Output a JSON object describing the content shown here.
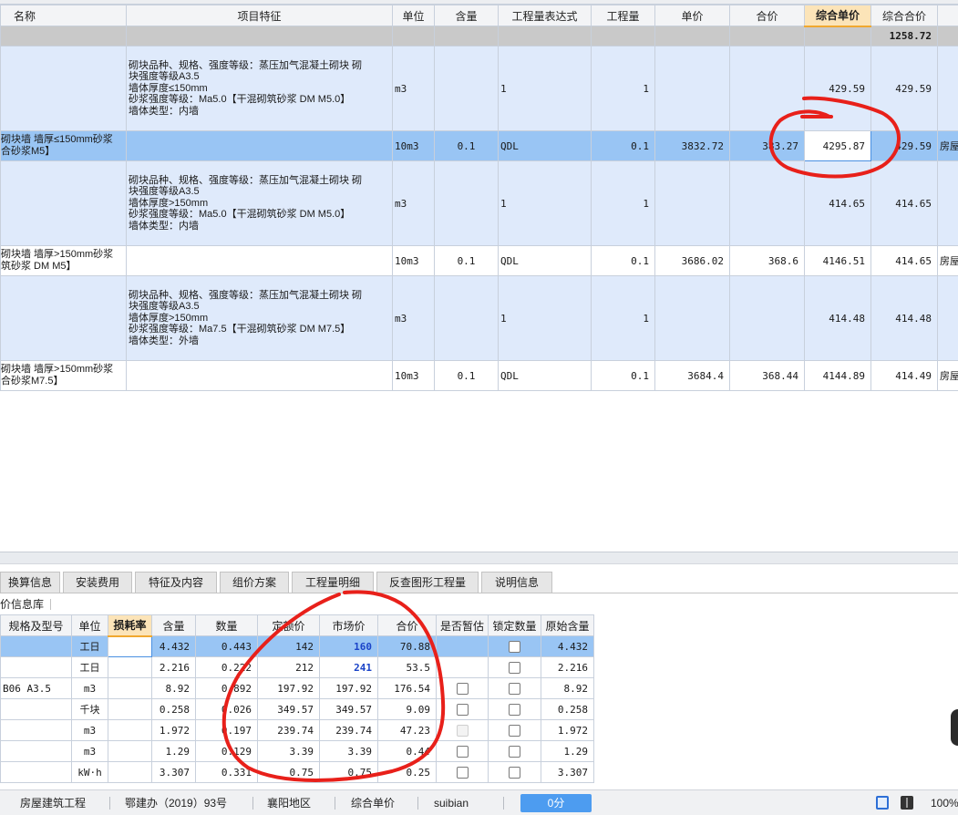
{
  "top_headers": [
    "名称",
    "项目特征",
    "单位",
    "含量",
    "工程量表达式",
    "工程量",
    "单价",
    "合价",
    "综合单价",
    "综合合价",
    ""
  ],
  "summary_total": "1258.72",
  "rows": [
    {
      "kind": "desc",
      "name": "",
      "feature": [
        "砌块品种、规格、强度等级：蒸压加气混凝土砌块 砌",
        "块强度等级A3.5",
        "墙体厚度≤150mm",
        "砂浆强度等级：Ma5.0【干混砌筑砂浆 DM M5.0】",
        "墙体类型：内墙"
      ],
      "unit": "m3",
      "content": "",
      "expr": "1",
      "qty": "1",
      "price": "",
      "total": "",
      "comp_price": "429.59",
      "comp_total": "429.59",
      "extra": ""
    },
    {
      "kind": "sel",
      "name": [
        "砌块墙 墙厚≤150mm砂浆",
        "合砂浆M5】"
      ],
      "feature": [],
      "unit": "10m3",
      "content": "0.1",
      "expr": "QDL",
      "qty": "0.1",
      "price": "3832.72",
      "total": "383.27",
      "comp_price": "4295.87",
      "comp_total": "429.59",
      "extra": "房屋"
    },
    {
      "kind": "desc",
      "name": "",
      "feature": [
        "砌块品种、规格、强度等级：蒸压加气混凝土砌块 砌",
        "块强度等级A3.5",
        "墙体厚度>150mm",
        "砂浆强度等级：Ma5.0【干混砌筑砂浆 DM M5.0】",
        "墙体类型：内墙"
      ],
      "unit": "m3",
      "content": "",
      "expr": "1",
      "qty": "1",
      "price": "",
      "total": "",
      "comp_price": "414.65",
      "comp_total": "414.65",
      "extra": ""
    },
    {
      "kind": "sub",
      "name": [
        "砌块墙 墙厚>150mm砂浆",
        "筑砂浆 DM M5】"
      ],
      "feature": [],
      "unit": "10m3",
      "content": "0.1",
      "expr": "QDL",
      "qty": "0.1",
      "price": "3686.02",
      "total": "368.6",
      "comp_price": "4146.51",
      "comp_total": "414.65",
      "extra": "房屋"
    },
    {
      "kind": "desc",
      "name": "",
      "feature": [
        "砌块品种、规格、强度等级：蒸压加气混凝土砌块 砌",
        "块强度等级A3.5",
        "墙体厚度>150mm",
        "砂浆强度等级：Ma7.5【干混砌筑砂浆 DM M7.5】",
        "墙体类型：外墙"
      ],
      "unit": "m3",
      "content": "",
      "expr": "1",
      "qty": "1",
      "price": "",
      "total": "",
      "comp_price": "414.48",
      "comp_total": "414.48",
      "extra": ""
    },
    {
      "kind": "sub",
      "name": [
        "砌块墙 墙厚>150mm砂浆",
        "合砂浆M7.5】"
      ],
      "feature": [],
      "unit": "10m3",
      "content": "0.1",
      "expr": "QDL",
      "qty": "0.1",
      "price": "3684.4",
      "total": "368.44",
      "comp_price": "4144.89",
      "comp_total": "414.49",
      "extra": "房屋"
    }
  ],
  "tabs": [
    "换算信息",
    "安装费用",
    "特征及内容",
    "组价方案",
    "工程量明细",
    "反查图形工程量",
    "说明信息"
  ],
  "lib_label": "价信息库",
  "bottom_headers": [
    "规格及型号",
    "单位",
    "损耗率",
    "含量",
    "数量",
    "定额价",
    "市场价",
    "合价",
    "是否暂估",
    "锁定数量",
    "原始含量"
  ],
  "bottom_rows": [
    {
      "spec": "",
      "unit": "工日",
      "loss": "",
      "content": "4.432",
      "qty": "0.443",
      "quota": "142",
      "market": "160",
      "total": "70.88",
      "market_bold": true,
      "est": "none",
      "lock": "box",
      "orig": "4.432"
    },
    {
      "spec": "",
      "unit": "工日",
      "loss": "",
      "content": "2.216",
      "qty": "0.222",
      "quota": "212",
      "market": "241",
      "total": "53.5",
      "market_bold": true,
      "est": "none",
      "lock": "box",
      "orig": "2.216"
    },
    {
      "spec": "B06 A3.5",
      "unit": "m3",
      "loss": "",
      "content": "8.92",
      "qty": "0.892",
      "quota": "197.92",
      "market": "197.92",
      "total": "176.54",
      "market_bold": false,
      "est": "box",
      "lock": "box",
      "orig": "8.92"
    },
    {
      "spec": "",
      "unit": "千块",
      "loss": "",
      "content": "0.258",
      "qty": "0.026",
      "quota": "349.57",
      "market": "349.57",
      "total": "9.09",
      "market_bold": false,
      "est": "box",
      "lock": "box",
      "orig": "0.258"
    },
    {
      "spec": "",
      "unit": "m3",
      "loss": "",
      "content": "1.972",
      "qty": "0.197",
      "quota": "239.74",
      "market": "239.74",
      "total": "47.23",
      "market_bold": false,
      "est": "dis",
      "lock": "box",
      "orig": "1.972"
    },
    {
      "spec": "",
      "unit": "m3",
      "loss": "",
      "content": "1.29",
      "qty": "0.129",
      "quota": "3.39",
      "market": "3.39",
      "total": "0.44",
      "market_bold": false,
      "est": "box",
      "lock": "box",
      "orig": "1.29"
    },
    {
      "spec": "",
      "unit": "kW·h",
      "loss": "",
      "content": "3.307",
      "qty": "0.331",
      "quota": "0.75",
      "market": "0.75",
      "total": "0.25",
      "market_bold": false,
      "est": "box",
      "lock": "box",
      "orig": "3.307"
    }
  ],
  "status": {
    "project": "房屋建筑工程",
    "doc": "鄂建办（2019）93号",
    "region": "襄阳地区",
    "mode": "综合单价",
    "user": "suibian",
    "score": "0分",
    "zoom": "100%"
  },
  "colors": {
    "selected_row": "#99c5f4",
    "desc_row": "#dfeafb",
    "header_highlight": "#fce4b8",
    "annotation_red": "#e8201a",
    "progress_blue": "#4d9cf0"
  }
}
